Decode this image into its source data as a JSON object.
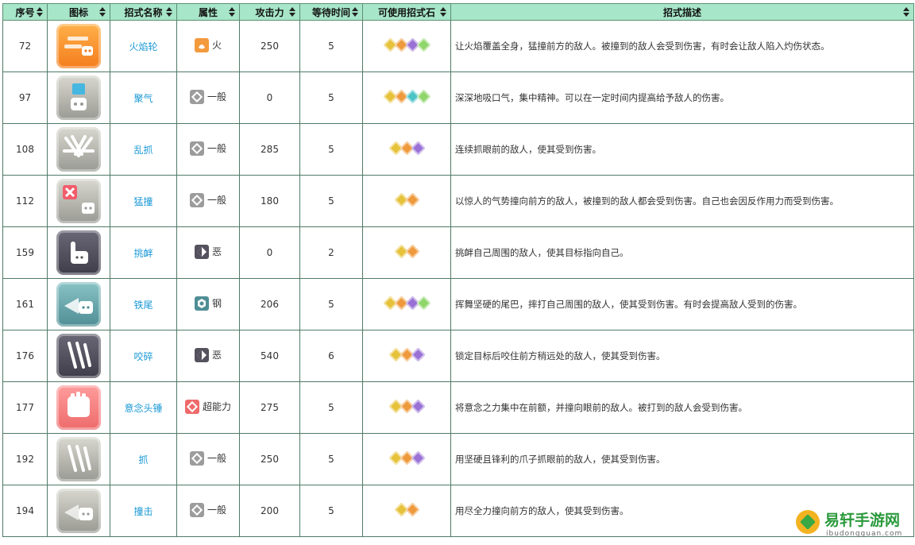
{
  "headers": [
    "序号",
    "图标",
    "招式名称",
    "属性",
    "攻击力",
    "等待时间",
    "可使用招式石",
    "招式描述"
  ],
  "rows": [
    {
      "id": "72",
      "icon": "fire-wheel-icon",
      "name": "火焰轮",
      "type": "火",
      "type_icon": "fire-type-icon",
      "power": "250",
      "wait": "5",
      "stones": [
        "yellow",
        "orange",
        "purple",
        "green"
      ],
      "desc": "让火焰覆盖全身，猛撞前方的敌人。被撞到的敌人会受到伤害，有时会让敌人陷入灼伤状态。"
    },
    {
      "id": "97",
      "icon": "focus-energy-icon",
      "name": "聚气",
      "type": "一般",
      "type_icon": "normal-type-icon",
      "power": "0",
      "wait": "5",
      "stones": [
        "yellow",
        "orange",
        "teal",
        "green"
      ],
      "desc": "深深地吸口气，集中精神。可以在一定时间内提高给予敌人的伤害。"
    },
    {
      "id": "108",
      "icon": "fury-swipes-icon",
      "name": "乱抓",
      "type": "一般",
      "type_icon": "normal-type-icon",
      "power": "285",
      "wait": "5",
      "stones": [
        "yellow",
        "orange",
        "purple"
      ],
      "desc": "连续抓眼前的敌人，使其受到伤害。"
    },
    {
      "id": "112",
      "icon": "take-down-icon",
      "name": "猛撞",
      "type": "一般",
      "type_icon": "normal-type-icon",
      "power": "180",
      "wait": "5",
      "stones": [
        "yellow",
        "orange"
      ],
      "desc": "以惊人的气势撞向前方的敌人，被撞到的敌人都会受到伤害。自己也会因反作用力而受到伤害。"
    },
    {
      "id": "159",
      "icon": "taunt-icon",
      "name": "挑衅",
      "type": "恶",
      "type_icon": "dark-type-icon",
      "power": "0",
      "wait": "2",
      "stones": [
        "yellow",
        "orange"
      ],
      "desc": "挑衅自己周围的敌人，使其目标指向自己。"
    },
    {
      "id": "161",
      "icon": "iron-tail-icon",
      "name": "铁尾",
      "type": "钢",
      "type_icon": "steel-type-icon",
      "power": "206",
      "wait": "5",
      "stones": [
        "yellow",
        "orange",
        "purple",
        "green"
      ],
      "desc": "挥舞坚硬的尾巴，摔打自己周围的敌人，使其受到伤害。有时会提高敌人受到的伤害。"
    },
    {
      "id": "176",
      "icon": "crunch-icon",
      "name": "咬碎",
      "type": "恶",
      "type_icon": "dark-type-icon",
      "power": "540",
      "wait": "6",
      "stones": [
        "yellow",
        "orange",
        "purple"
      ],
      "desc": "锁定目标后咬住前方稍远处的敌人，使其受到伤害。"
    },
    {
      "id": "177",
      "icon": "zen-headbutt-icon",
      "name": "意念头锤",
      "type": "超能力",
      "type_icon": "psychic-type-icon",
      "power": "275",
      "wait": "5",
      "stones": [
        "yellow",
        "orange",
        "purple"
      ],
      "desc": "将意念之力集中在前额，并撞向眼前的敌人。被打到的敌人会受到伤害。"
    },
    {
      "id": "192",
      "icon": "scratch-icon",
      "name": "抓",
      "type": "一般",
      "type_icon": "normal-type-icon",
      "power": "250",
      "wait": "5",
      "stones": [
        "yellow",
        "orange",
        "purple"
      ],
      "desc": "用坚硬且锋利的爪子抓眼前的敌人，使其受到伤害。"
    },
    {
      "id": "194",
      "icon": "tackle-icon",
      "name": "撞击",
      "type": "一般",
      "type_icon": "normal-type-icon",
      "power": "200",
      "wait": "5",
      "stones": [
        "yellow",
        "orange"
      ],
      "desc": "用尽全力撞向前方的敌人，使其受到伤害。"
    }
  ],
  "colors": {
    "header_bg": "#a7e6c8",
    "link": "#1d9ad6",
    "stone_yellow": "#e6c23a",
    "stone_orange": "#ee9a3c",
    "stone_purple": "#9a72d6",
    "stone_green": "#8fd66a",
    "stone_teal": "#4cc3c7",
    "fire": "#f39a3d",
    "normal": "#9c9c9c",
    "dark": "#55525e",
    "steel": "#4f8e95",
    "psychic": "#ee6b6b"
  },
  "watermark": {
    "title": "易轩手游网",
    "subtitle": "ibudongguan.com"
  }
}
